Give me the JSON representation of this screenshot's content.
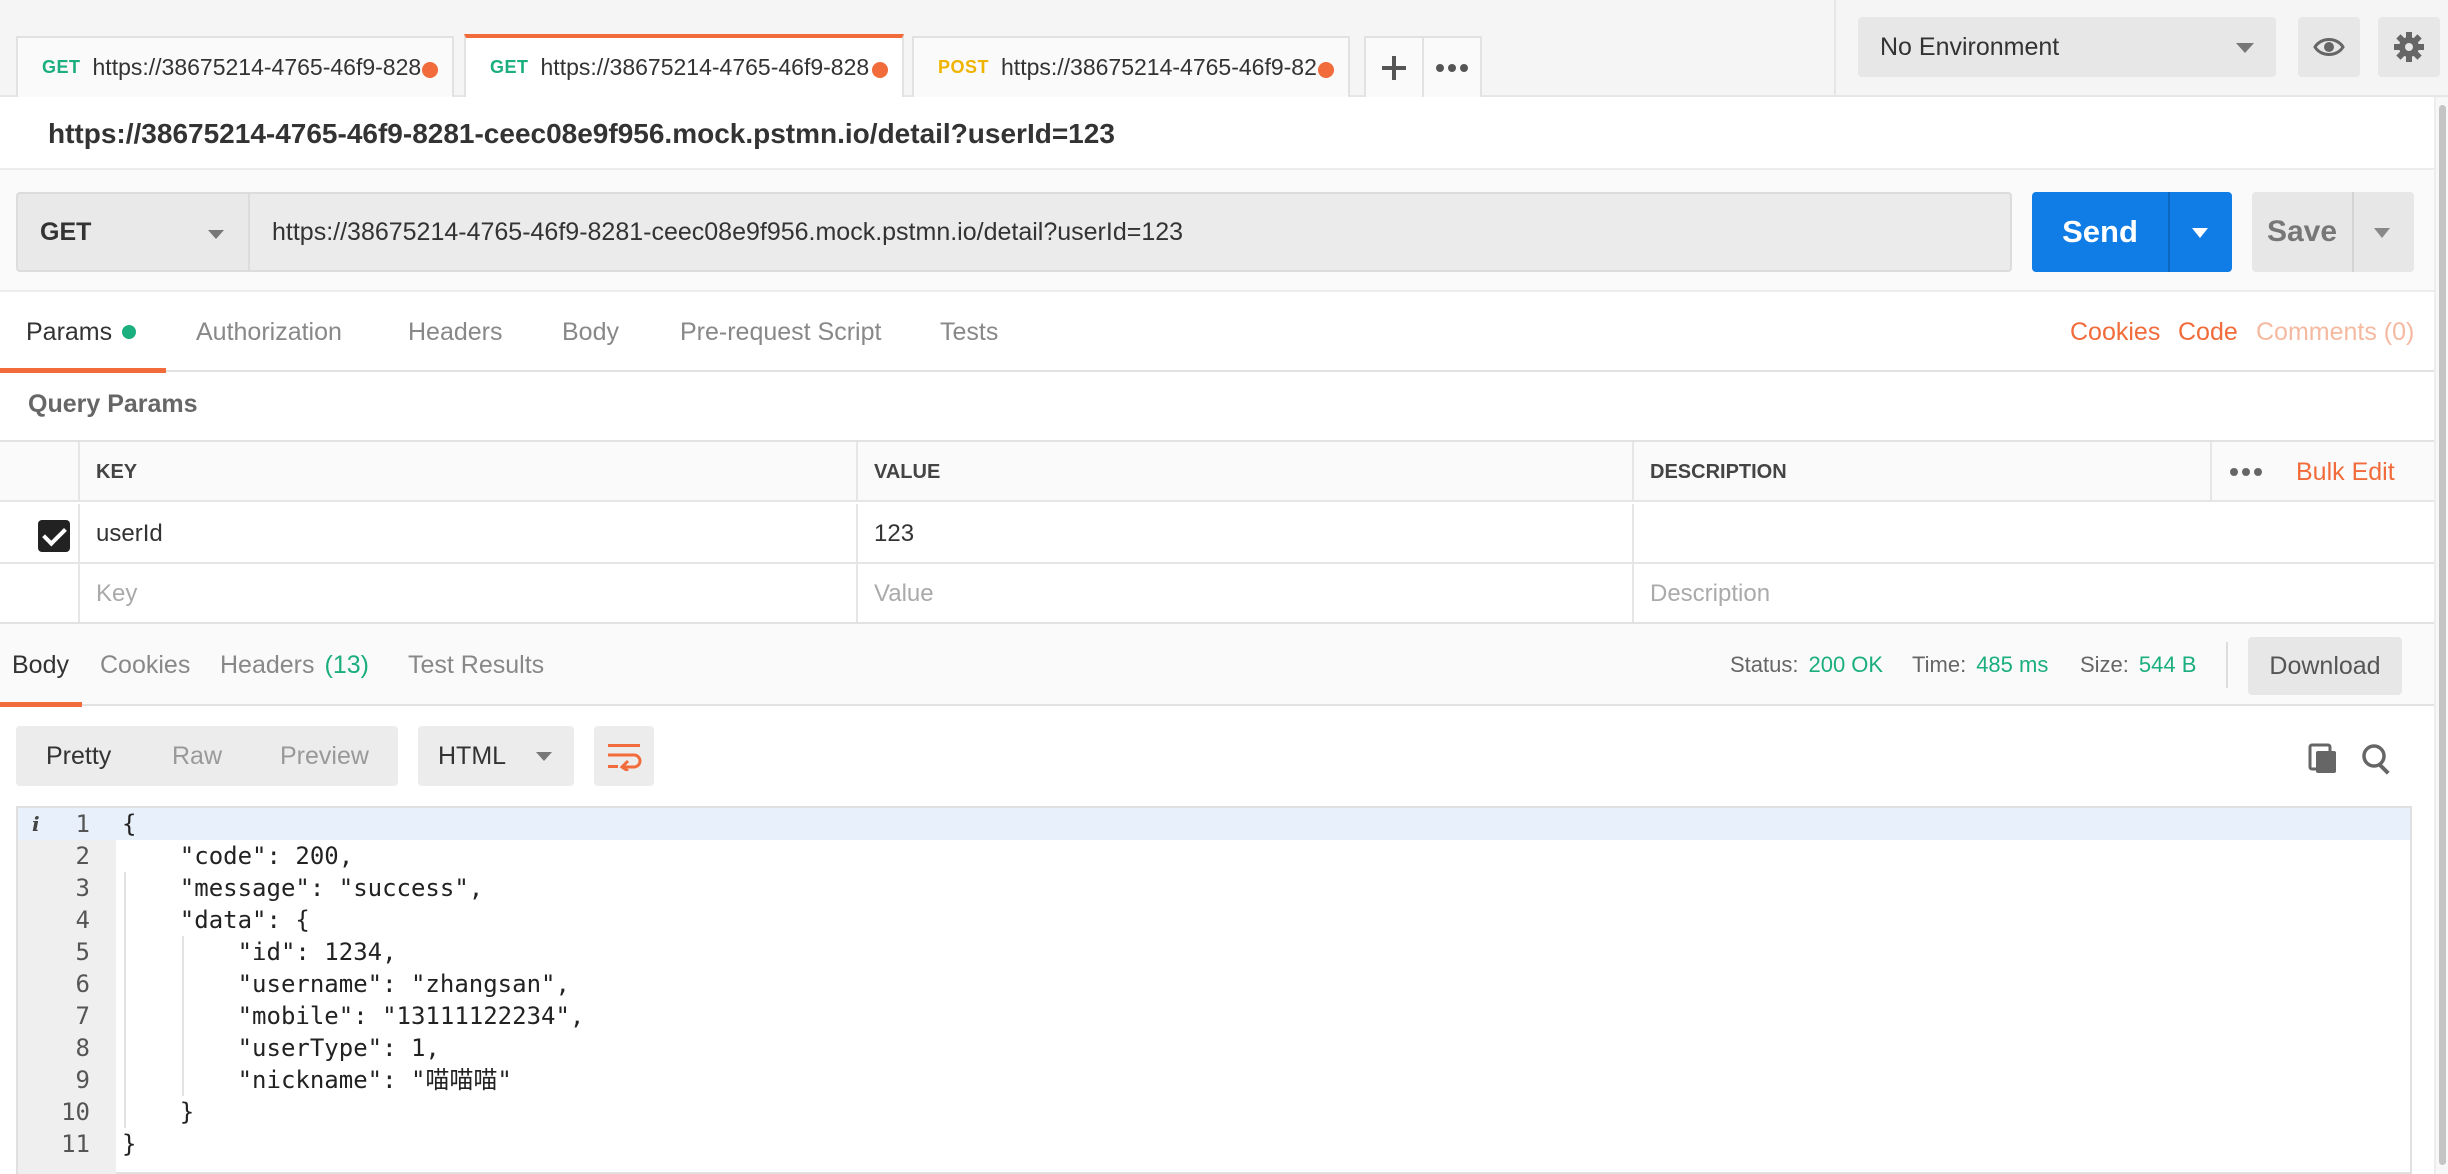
{
  "tabs": [
    {
      "method": "GET",
      "url": "https://38675214-4765-46f9-828",
      "unsaved": true,
      "active": false
    },
    {
      "method": "GET",
      "url": "https://38675214-4765-46f9-828",
      "unsaved": true,
      "active": true
    },
    {
      "method": "POST",
      "url": "https://38675214-4765-46f9-82",
      "unsaved": true,
      "active": false
    }
  ],
  "tab_actions": {
    "new_tab_icon": "plus-icon",
    "more_icon": "ellipsis-icon"
  },
  "environment": {
    "selected": "No Environment",
    "quick_look_icon": "eye-icon",
    "settings_icon": "gear-icon"
  },
  "request": {
    "title": "https://38675214-4765-46f9-8281-ceec08e9f956.mock.pstmn.io/detail?userId=123",
    "method": "GET",
    "url": "https://38675214-4765-46f9-8281-ceec08e9f956.mock.pstmn.io/detail?userId=123",
    "send_label": "Send",
    "save_label": "Save"
  },
  "request_tabs": {
    "items": [
      "Params",
      "Authorization",
      "Headers",
      "Body",
      "Pre-request Script",
      "Tests"
    ],
    "active": "Params",
    "cookies_link": "Cookies",
    "code_link": "Code",
    "comments_link": "Comments (0)"
  },
  "query_params": {
    "title": "Query Params",
    "headers": {
      "key": "KEY",
      "value": "VALUE",
      "description": "DESCRIPTION"
    },
    "bulk_edit": "Bulk Edit",
    "rows": [
      {
        "checked": true,
        "key": "userId",
        "value": "123",
        "description": ""
      }
    ],
    "placeholders": {
      "key": "Key",
      "value": "Value",
      "description": "Description"
    }
  },
  "response": {
    "tabs": {
      "body": "Body",
      "cookies": "Cookies",
      "headers": "Headers",
      "headers_count": "(13)",
      "test_results": "Test Results"
    },
    "status_label": "Status:",
    "status_value": "200 OK",
    "time_label": "Time:",
    "time_value": "485 ms",
    "size_label": "Size:",
    "size_value": "544 B",
    "download_label": "Download",
    "view_modes": [
      "Pretty",
      "Raw",
      "Preview"
    ],
    "active_view": "Pretty",
    "format": "HTML",
    "accent": "#f26b3a",
    "success_color": "#1bae7f",
    "send_color": "#107ce6"
  },
  "editor": {
    "lines": [
      "{",
      "    \"code\": 200,",
      "    \"message\": \"success\",",
      "    \"data\": {",
      "        \"id\": 1234,",
      "        \"username\": \"zhangsan\",",
      "        \"mobile\": \"13111122234\",",
      "        \"userType\": 1,",
      "        \"nickname\": \"喵喵喵\"",
      "    }",
      "}"
    ],
    "line_numbers": [
      "1",
      "2",
      "3",
      "4",
      "5",
      "6",
      "7",
      "8",
      "9",
      "10",
      "11"
    ]
  }
}
